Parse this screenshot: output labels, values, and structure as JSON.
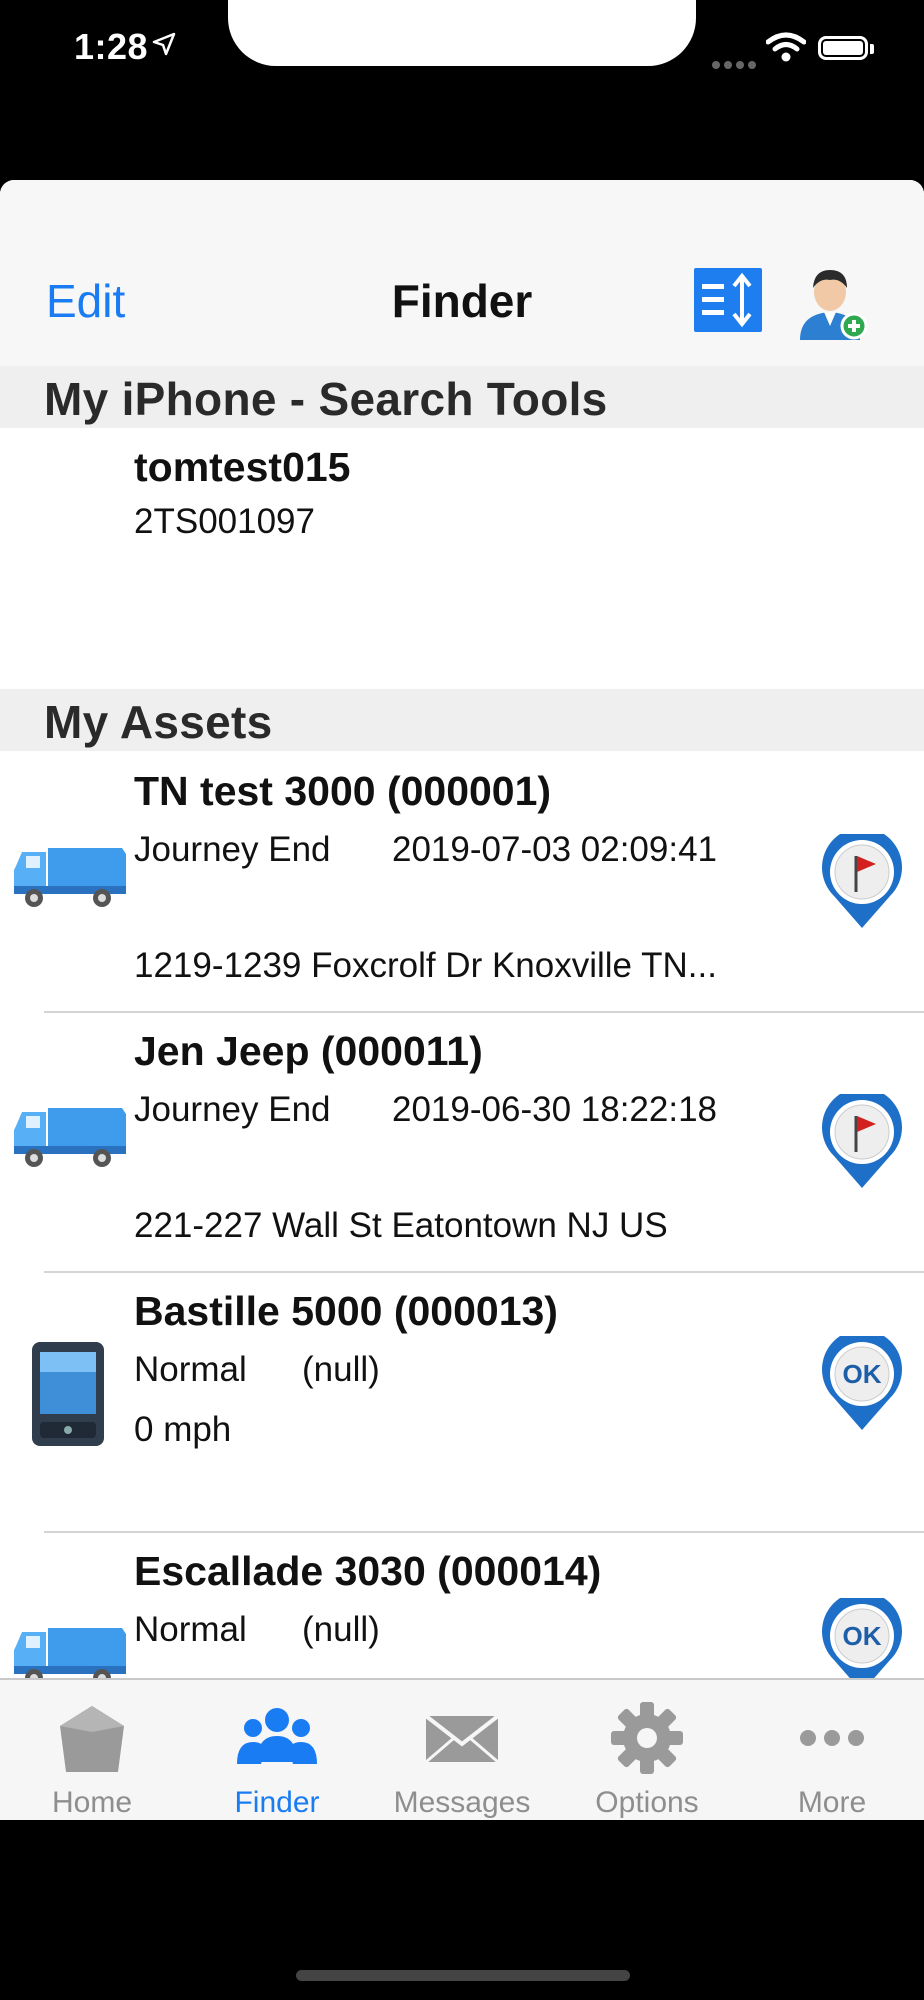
{
  "status_bar": {
    "time": "1:28"
  },
  "nav": {
    "edit_label": "Edit",
    "title": "Finder"
  },
  "sections": {
    "my_iphone": "My iPhone - Search Tools",
    "my_assets": "My Assets"
  },
  "device": {
    "name": "tomtest015",
    "id": "2TS001097"
  },
  "assets": [
    {
      "title": "TN test 3000 (000001)",
      "status": "Journey End",
      "time": "2019-07-03 02:09:41",
      "address": "1219-1239 Foxcrolf Dr Knoxville TN...",
      "icon": "truck-icon",
      "badge": "flag-pin-icon"
    },
    {
      "title": "Jen Jeep (000011)",
      "status": "Journey End",
      "time": "2019-06-30 18:22:18",
      "address": "221-227 Wall St Eatontown NJ US",
      "icon": "truck-icon",
      "badge": "flag-pin-icon"
    },
    {
      "title": "Bastille 5000 (000013)",
      "status": "Normal",
      "time": "(null)",
      "address": "0 mph",
      "icon": "phone-device-icon",
      "badge": "ok-pin-icon"
    },
    {
      "title": "Escallade 3030 (000014)",
      "status": "Normal",
      "time": "(null)",
      "address": "",
      "icon": "truck-icon",
      "badge": "ok-pin-icon"
    }
  ],
  "badge_ok_text": "OK",
  "tabs": [
    {
      "label": "Home",
      "icon": "home-icon"
    },
    {
      "label": "Finder",
      "icon": "people-icon"
    },
    {
      "label": "Messages",
      "icon": "envelope-icon"
    },
    {
      "label": "Options",
      "icon": "gear-icon"
    },
    {
      "label": "More",
      "icon": "more-dots-icon"
    }
  ],
  "colors": {
    "accent": "#1a7cf2",
    "tab_inactive": "#8e8e8e",
    "section_bg": "#efeff0"
  }
}
